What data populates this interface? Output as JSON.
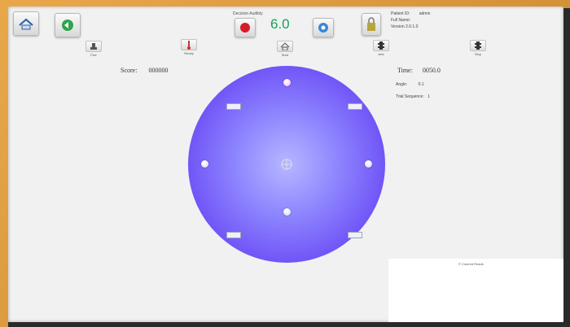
{
  "toolbar": {
    "timer_title": "Decision Audibly",
    "timer_value": "6.0",
    "record_color": "#d51d2a",
    "timer_color": "#16a05a"
  },
  "user_info": {
    "line1_label": "Patient ID:",
    "line1_value": "admin",
    "line2": "Full Name:",
    "line3": "Version 2.0.1.0"
  },
  "tools": [
    {
      "label": "Five"
    },
    {
      "label": "Ready"
    },
    {
      "label": "Start"
    },
    {
      "label": "sets"
    },
    {
      "label": "Stop"
    }
  ],
  "score": {
    "label": "Score:",
    "value": "000000"
  },
  "time": {
    "label": "Time:",
    "value": "0050.0"
  },
  "params": [
    {
      "label": "Angle:",
      "value": "0.1"
    },
    {
      "label": "Trial Sequence:",
      "value": "1"
    }
  ],
  "footer_note": "© Colored Reads",
  "arena_color": "#6d4ff6"
}
